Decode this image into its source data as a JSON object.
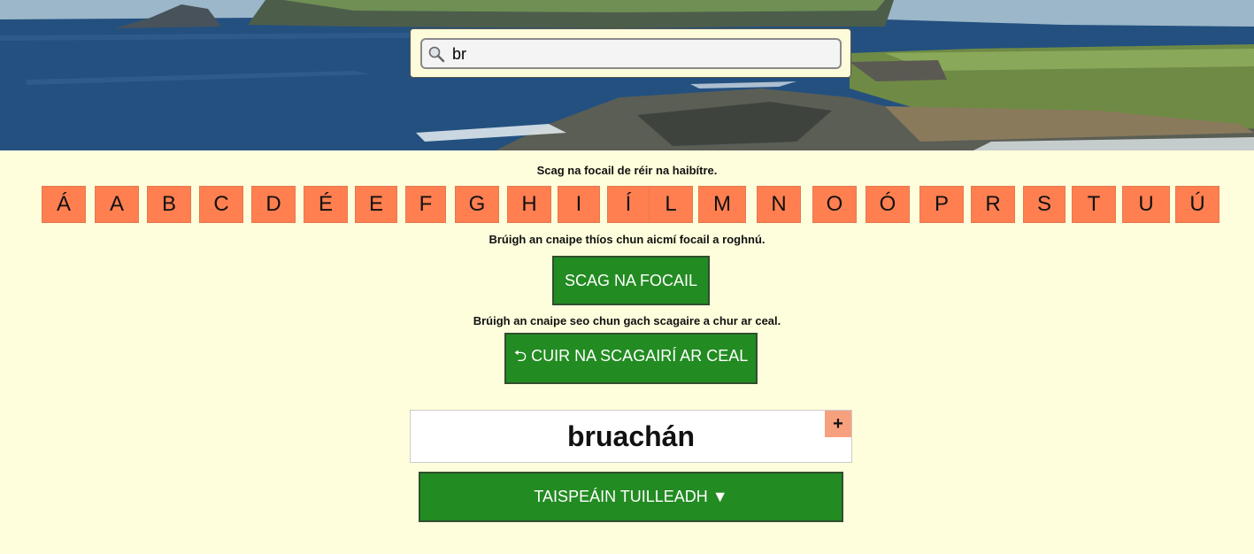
{
  "search": {
    "value": "br",
    "placeholder": ""
  },
  "filters": {
    "alphabet_caption": "Scag na focail de réir na haibítre.",
    "letters": [
      "Á",
      "A",
      "B",
      "C",
      "D",
      "É",
      "E",
      "F",
      "G",
      "H",
      "I",
      "Í",
      "L",
      "M",
      "N",
      "O",
      "Ó",
      "P",
      "R",
      "S",
      "T",
      "U",
      "Ú"
    ],
    "category_caption": "Brúigh an cnaipe thíos chun aicmí focail a roghnú.",
    "filter_words_label": "SCAG NA FOCAIL",
    "reset_caption": "Brúigh an cnaipe seo chun gach scagaire a chur ar ceal.",
    "reset_label": "⮌ CUIR NA SCAGAIRÍ AR CEAL"
  },
  "results": {
    "word": "bruachán",
    "add_label": "+",
    "show_more_label": "TAISPEÁIN TUILLEADH ▼"
  },
  "colors": {
    "background": "#fffedc",
    "letter_button": "#ff7f50",
    "primary_button": "#228b22",
    "add_button": "#f7a07e"
  },
  "icons": {
    "search": "search-icon"
  }
}
